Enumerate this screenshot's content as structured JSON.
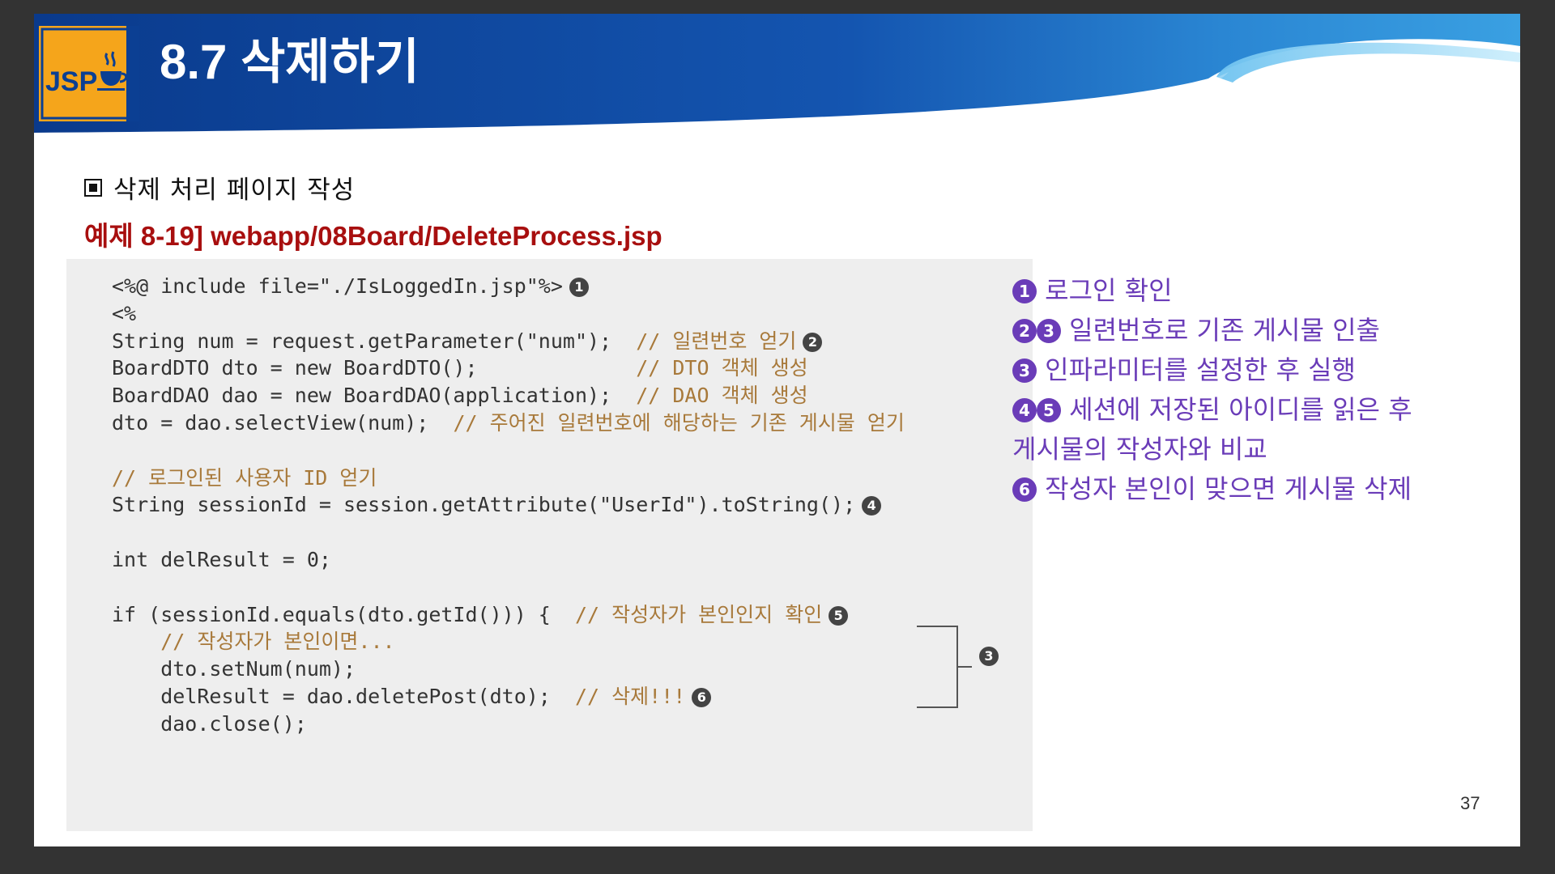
{
  "header": {
    "title": "8.7 삭제하기",
    "logo_text": "JSP",
    "logo_icon": "java-cup-icon",
    "colors": {
      "banner_dark": "#0b3f93",
      "banner_light": "#2e8ad6",
      "logo_orange": "#f5a51b"
    }
  },
  "section": {
    "heading": "삭제 처리 페이지 작성",
    "example_caption": "예제 8-19] webapp/08Board/DeleteProcess.jsp"
  },
  "code": {
    "lines": [
      {
        "code": "<%@ include file=\"./IsLoggedIn.jsp\"%>",
        "comment": "",
        "marker": "1"
      },
      {
        "code": "<%",
        "comment": "",
        "marker": ""
      },
      {
        "code": "String num = request.getParameter(\"num\");  ",
        "comment": "// 일련번호 얻기",
        "marker": "2"
      },
      {
        "code": "BoardDTO dto = new BoardDTO();             ",
        "comment": "// DTO 객체 생성",
        "marker": ""
      },
      {
        "code": "BoardDAO dao = new BoardDAO(application);  ",
        "comment": "// DAO 객체 생성",
        "marker": ""
      },
      {
        "code": "dto = dao.selectView(num);  ",
        "comment": "// 주어진 일련번호에 해당하는 기존 게시물 얻기",
        "marker": ""
      },
      {
        "code": "",
        "comment": "",
        "marker": ""
      },
      {
        "code": "",
        "comment": "// 로그인된 사용자 ID 얻기",
        "marker": ""
      },
      {
        "code": "String sessionId = session.getAttribute(\"UserId\").toString();",
        "comment": "",
        "marker": "4"
      },
      {
        "code": "",
        "comment": "",
        "marker": ""
      },
      {
        "code": "int delResult = 0;",
        "comment": "",
        "marker": ""
      },
      {
        "code": "",
        "comment": "",
        "marker": ""
      },
      {
        "code": "if (sessionId.equals(dto.getId())) {  ",
        "comment": "// 작성자가 본인인지 확인",
        "marker": "5"
      },
      {
        "code": "    ",
        "comment": "// 작성자가 본인이면...",
        "marker": ""
      },
      {
        "code": "    dto.setNum(num);",
        "comment": "",
        "marker": ""
      },
      {
        "code": "    delResult = dao.deletePost(dto);  ",
        "comment": "// 삭제!!!",
        "marker": "6"
      },
      {
        "code": "    dao.close();",
        "comment": "",
        "marker": ""
      }
    ],
    "bracket_marker": "3"
  },
  "notes": [
    {
      "markers": [
        "1"
      ],
      "text": "로그인 확인"
    },
    {
      "markers": [
        "2",
        "3"
      ],
      "text": "일련번호로 기존 게시물 인출"
    },
    {
      "markers": [
        "3"
      ],
      "text": "인파라미터를 설정한 후 실행"
    },
    {
      "markers": [
        "4",
        "5"
      ],
      "text": "세션에 저장된 아이디를 읽은 후"
    },
    {
      "markers": [],
      "text": "게시물의 작성자와 비교"
    },
    {
      "markers": [
        "6"
      ],
      "text": "작성자 본인이 맞으면 게시물 삭제"
    }
  ],
  "page_number": "37"
}
